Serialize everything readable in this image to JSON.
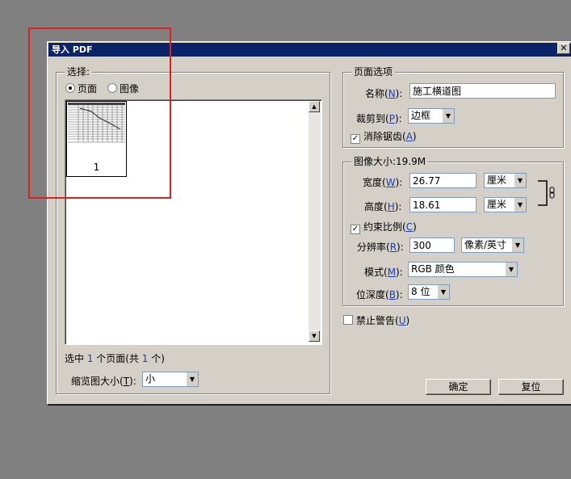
{
  "dialog": {
    "title": "导入 PDF",
    "close_glyph": "✕"
  },
  "select_group": {
    "legend": "选择:",
    "radio_page": "页面",
    "radio_image": "图像",
    "thumbnail_page_number": "1",
    "selection_status_pre": "选中 ",
    "selection_count": "1",
    "selection_status_mid": " 个页面(共 ",
    "total_count": "1",
    "selection_status_post": " 个)",
    "thumb_size_label_pre": "缩览图大小(",
    "thumb_size_key": "T",
    "thumb_size_label_post": "):",
    "thumb_size_value": "小"
  },
  "page_options": {
    "legend": "页面选项",
    "name_label_pre": "名称(",
    "name_key": "N",
    "name_label_post": "):",
    "name_value": "施工横道图",
    "crop_label_pre": "裁剪到(",
    "crop_key": "P",
    "crop_label_post": "):",
    "crop_value": "边框",
    "antialias_label_pre": "消除锯齿(",
    "antialias_key": "A",
    "antialias_label_post": ")",
    "antialias_checked": true
  },
  "image_size": {
    "legend": "图像大小:19.9M",
    "width_label_pre": "宽度(",
    "width_key": "W",
    "width_label_post": "):",
    "width_value": "26.77",
    "width_unit": "厘米",
    "height_label_pre": "高度(",
    "height_key": "H",
    "height_label_post": "):",
    "height_value": "18.61",
    "height_unit": "厘米",
    "constrain_label_pre": "约束比例(",
    "constrain_key": "C",
    "constrain_label_post": ")",
    "constrain_checked": true,
    "resolution_label_pre": "分辨率(",
    "resolution_key": "R",
    "resolution_label_post": "):",
    "resolution_value": "300",
    "resolution_unit": "像素/英寸",
    "mode_label_pre": "模式(",
    "mode_key": "M",
    "mode_label_post": "):",
    "mode_value": "RGB 颜色",
    "depth_label_pre": "位深度(",
    "depth_key": "B",
    "depth_label_post": "):",
    "depth_value": "8 位"
  },
  "suppress_warnings": {
    "label_pre": "禁止警告(",
    "key": "U",
    "label_post": ")",
    "checked": false
  },
  "buttons": {
    "ok": "确定",
    "reset": "复位"
  },
  "icons": {
    "link": "chain-link-icon",
    "dropdown": "chevron-down-icon",
    "scroll_up": "scroll-up-icon",
    "scroll_down": "scroll-down-icon"
  },
  "colors": {
    "titlebar": "#0a246a",
    "highlight_box": "#e0201a",
    "accent_text": "#1c3fb5"
  }
}
